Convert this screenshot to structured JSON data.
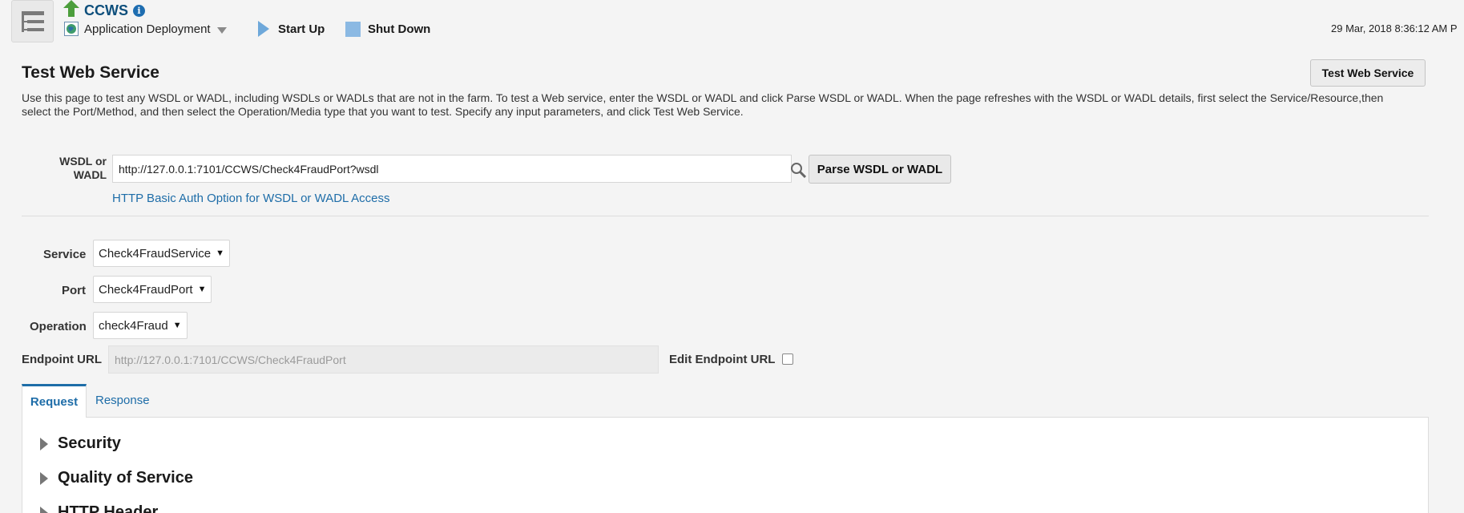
{
  "header": {
    "app_name": "CCWS",
    "target_menu_label": "Application Deployment",
    "start_up_label": "Start Up",
    "shut_down_label": "Shut Down",
    "timestamp": "29 Mar, 2018 8:36:12 AM P"
  },
  "page": {
    "title": "Test Web Service",
    "test_button_label": "Test Web Service",
    "description": "Use this page to test any WSDL or WADL, including WSDLs or WADLs that are not in the farm. To test a Web service, enter the WSDL or WADL and click Parse WSDL or WADL. When the page refreshes with the WSDL or WADL details, first select the Service/Resource,then select the Port/Method, and then select the Operation/Media type that you want to test. Specify any input parameters, and click Test Web Service."
  },
  "wsdl": {
    "label": "WSDL or WADL",
    "value": "http://127.0.0.1:7101/CCWS/Check4FraudPort?wsdl",
    "parse_button_label": "Parse WSDL or WADL",
    "auth_link_label": "HTTP Basic Auth Option for WSDL or WADL Access"
  },
  "form": {
    "service_label": "Service",
    "service_value": "Check4FraudService",
    "port_label": "Port",
    "port_value": "Check4FraudPort",
    "operation_label": "Operation",
    "operation_value": "check4Fraud",
    "endpoint_label": "Endpoint URL",
    "endpoint_value": "http://127.0.0.1:7101/CCWS/Check4FraudPort",
    "edit_endpoint_label": "Edit Endpoint URL",
    "edit_endpoint_checked": false
  },
  "tabs": [
    {
      "label": "Request",
      "active": true
    },
    {
      "label": "Response",
      "active": false
    }
  ],
  "sections": [
    {
      "label": "Security"
    },
    {
      "label": "Quality of Service"
    },
    {
      "label": "HTTP Header"
    }
  ],
  "colors": {
    "accent": "#1e6da8",
    "app_name": "#0e4f7c",
    "status_up": "#4c9e3c",
    "shutdown_square": "#8bb9e3"
  }
}
